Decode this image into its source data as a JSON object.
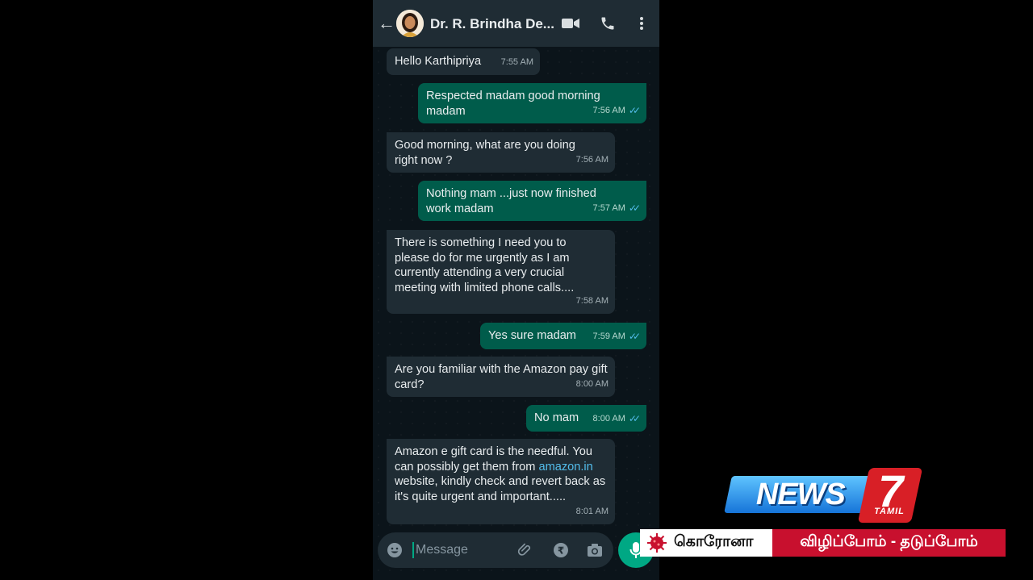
{
  "header": {
    "contact_name": "Dr. R. Brindha De...",
    "back_icon": "arrow-left-icon",
    "video_icon": "video-camera-icon",
    "call_icon": "phone-icon",
    "menu_icon": "more-vertical-icon"
  },
  "messages": [
    {
      "direction": "in",
      "text": "Hello Karthipriya",
      "time": "7:55 AM"
    },
    {
      "direction": "out",
      "text": "Respected madam good morning madam",
      "time": "7:56 AM"
    },
    {
      "direction": "in",
      "text": "Good morning, what are you doing right now ?",
      "time": "7:56 AM"
    },
    {
      "direction": "out",
      "text": "Nothing mam ...just now finished work madam",
      "time": "7:57 AM"
    },
    {
      "direction": "in",
      "text": "There is something I need you to please do for me urgently as I am currently attending a very crucial meeting with limited phone calls....",
      "time": "7:58 AM"
    },
    {
      "direction": "out",
      "text": "Yes sure madam",
      "time": "7:59 AM"
    },
    {
      "direction": "in",
      "text": "Are you familiar with the Amazon pay gift card?",
      "time": "8:00 AM"
    },
    {
      "direction": "out",
      "text": "No mam",
      "time": "8:00 AM"
    },
    {
      "direction": "in",
      "text_before": "Amazon e gift card is the needful. You can possibly get them from ",
      "link": "amazon.in",
      "text_after": " website, kindly check and revert back as it's quite urgent and important.....",
      "time": "8:01 AM"
    }
  ],
  "input": {
    "placeholder": "Message",
    "emoji_icon": "emoji-icon",
    "attach_icon": "paperclip-icon",
    "payment_icon": "rupee-icon",
    "camera_icon": "camera-icon",
    "mic_icon": "microphone-icon"
  },
  "overlay": {
    "logo_news": "NEWS",
    "logo_number": "7",
    "logo_tamil": "TAMIL",
    "ticker_left": "கொரோனா",
    "ticker_right": "விழிப்போம் - தடுப்போம்",
    "ticker_icon": "virus-icon"
  },
  "colors": {
    "header_bg": "#1f2c34",
    "chat_bg": "#0b141a",
    "incoming_bubble": "#1f2c34",
    "outgoing_bubble": "#005c4b",
    "read_tick": "#53bdeb",
    "accent": "#00a884",
    "ticker_red": "#c8102e"
  }
}
